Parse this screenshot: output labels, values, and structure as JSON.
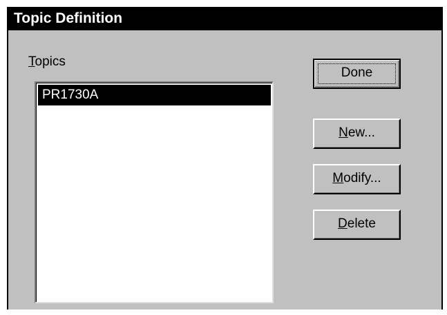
{
  "dialog": {
    "title": "Topic Definition"
  },
  "topics": {
    "label_mnemonic": "T",
    "label_rest": "opics",
    "items": [
      {
        "label": "PR1730A",
        "selected": true
      }
    ]
  },
  "buttons": {
    "done": "Done",
    "new_mnemonic": "N",
    "new_rest": "ew...",
    "modify_mnemonic": "M",
    "modify_rest": "odify...",
    "delete_mnemonic": "D",
    "delete_rest": "elete"
  }
}
